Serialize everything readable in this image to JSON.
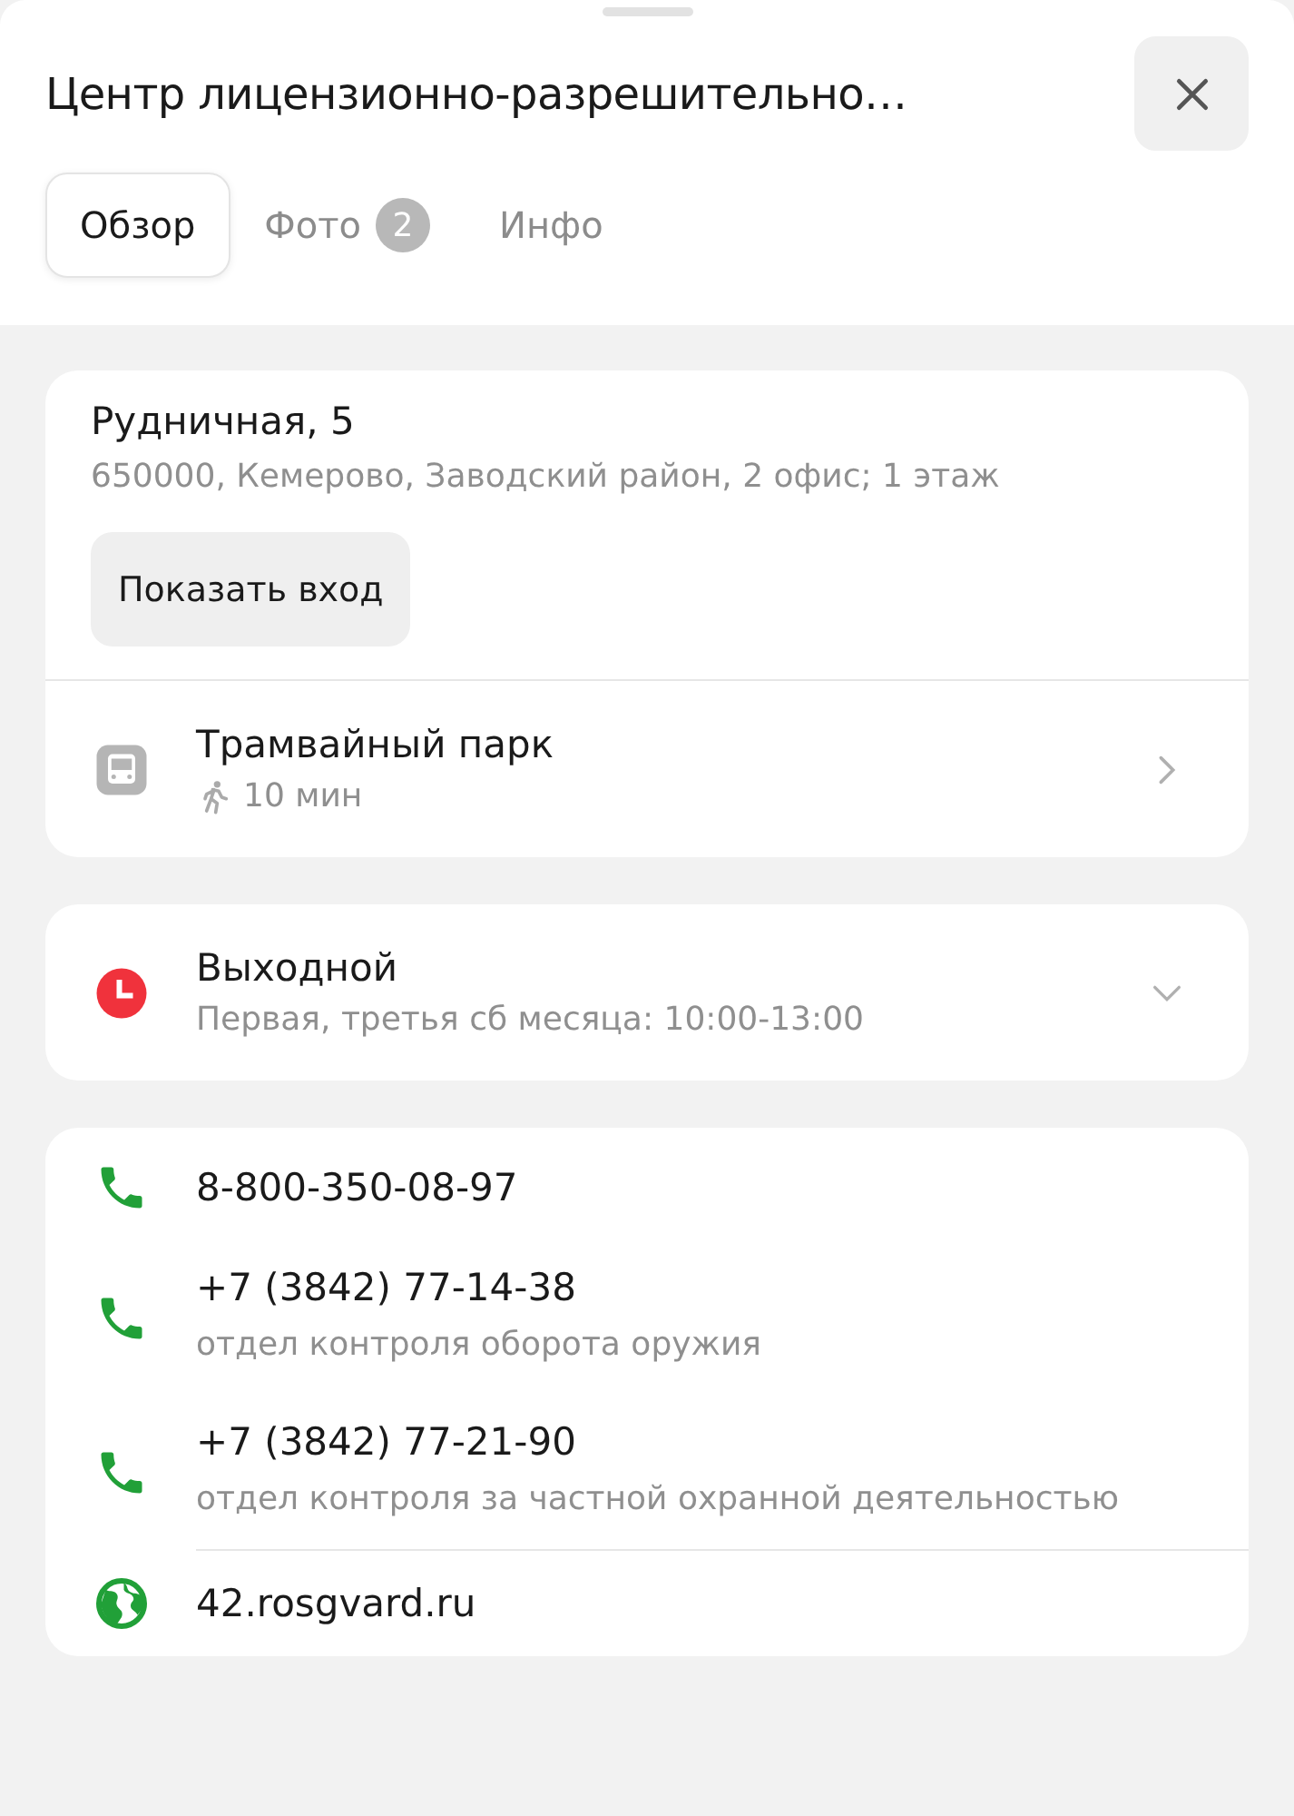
{
  "title": "Центр лицензионно-разрешительно…",
  "tabs": [
    {
      "label": "Обзор",
      "selected": true
    },
    {
      "label": "Фото",
      "badge": "2",
      "selected": false
    },
    {
      "label": "Инфо",
      "selected": false
    }
  ],
  "address": {
    "street": "Рудничная, 5",
    "details": "650000, Кемерово, Заводский район, 2 офис; 1 этаж",
    "button": "Показать вход"
  },
  "transit": {
    "stop": "Трамвайный парк",
    "walk_time": "10 мин"
  },
  "hours": {
    "status": "Выходной",
    "schedule": "Первая, третья сб месяца: 10:00-13:00",
    "expanded": false
  },
  "contacts": [
    {
      "kind": "phone",
      "value": "8-800-350-08-97"
    },
    {
      "kind": "phone",
      "value": "+7 (3842) 77-14-38",
      "note": "отдел контроля оборота оружия"
    },
    {
      "kind": "phone",
      "value": "+7 (3842) 77-21-90",
      "note": "отдел контроля за частной охранной деятельностью"
    },
    {
      "kind": "website",
      "value": "42.rosgvard.ru"
    }
  ]
}
